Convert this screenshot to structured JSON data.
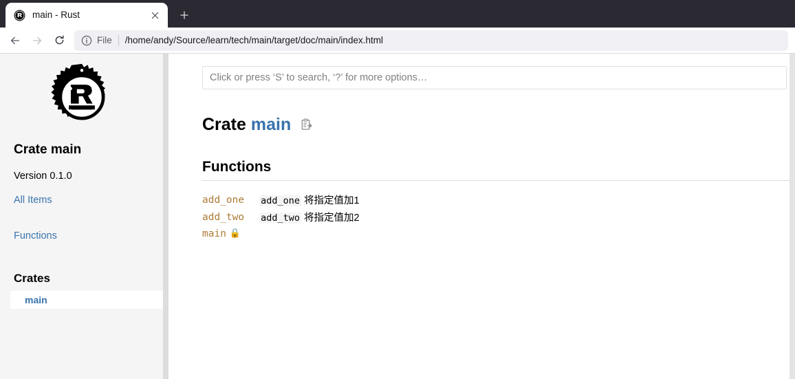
{
  "browser": {
    "tab": {
      "title": "main - Rust",
      "favicon_icon": "rust-favicon",
      "close_icon": "close-icon"
    },
    "new_tab_label": "+",
    "nav": {
      "back_icon": "back-arrow-icon",
      "forward_icon": "forward-arrow-icon",
      "reload_icon": "reload-icon"
    },
    "url": {
      "info_icon": "page-info-icon",
      "scheme_label": "File",
      "path": "/home/andy/Source/learn/tech/main/target/doc/main/index.html"
    }
  },
  "sidebar": {
    "logo_icon": "rust-logo-icon",
    "crate_title": "Crate main",
    "version": "Version 0.1.0",
    "all_items_label": "All Items",
    "functions_label": "Functions",
    "crates_heading": "Crates",
    "crates": [
      {
        "name": "main"
      }
    ]
  },
  "main": {
    "search": {
      "placeholder": "Click or press ‘S’ to search, ‘?’ for more options…",
      "value": ""
    },
    "heading": {
      "prefix": "Crate",
      "crate_name": "main",
      "copy_path_icon": "copy-path-icon"
    },
    "sections": [
      {
        "title": "Functions",
        "items": [
          {
            "name": "add_one",
            "code": "add_one",
            "desc": " 将指定值加1",
            "lock": ""
          },
          {
            "name": "add_two",
            "code": "add_two",
            "desc": " 将指定值加2",
            "lock": ""
          },
          {
            "name": "main",
            "code": "",
            "desc": "",
            "lock": "🔒"
          }
        ]
      }
    ]
  },
  "colors": {
    "link_blue": "#3873ad",
    "fn_orange": "#ad7c37",
    "sidebar_bg": "#f5f5f5",
    "chrome_dark": "#2b2a33"
  }
}
